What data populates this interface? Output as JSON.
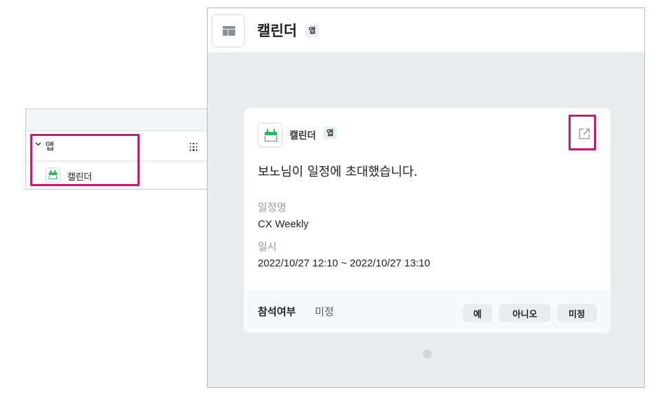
{
  "sidebar": {
    "section_label": "앱",
    "expand_icon": "chevron-down-icon",
    "apps_grid_icon": "grid-dots-icon",
    "items": [
      {
        "label": "캘린더",
        "icon": "calendar-icon"
      }
    ]
  },
  "header": {
    "layout_icon": "layout-icon",
    "title": "캘린더",
    "badge": "앱"
  },
  "card": {
    "app_icon": "calendar-icon",
    "app_name": "캘린더",
    "app_badge": "앱",
    "open_external_icon": "external-link-icon",
    "message": "보노님이 일정에 초대했습니다.",
    "fields": [
      {
        "label": "일정명",
        "value": "CX Weekly"
      },
      {
        "label": "일시",
        "value": "2022/10/27 12:10 ~ 2022/10/27 13:10"
      }
    ],
    "rsvp": {
      "label": "참석여부",
      "status": "미정",
      "buttons": [
        "예",
        "아니오",
        "미정"
      ]
    }
  },
  "colors": {
    "highlight": "#c8197a",
    "calendar_green": "#2dbb62",
    "window_background": "#eaecee"
  }
}
